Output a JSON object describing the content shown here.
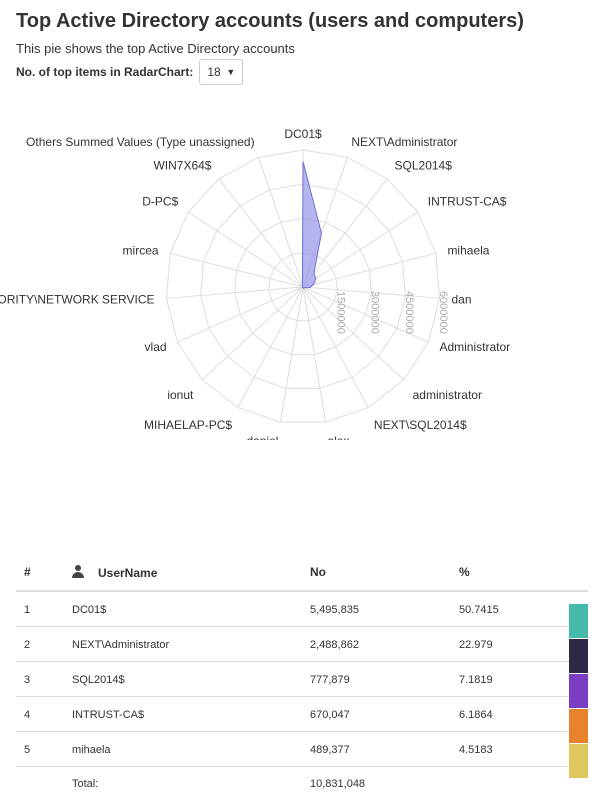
{
  "header": {
    "title": "Top Active Directory accounts (users and computers)",
    "subtitle": "This pie shows the top Active Directory accounts",
    "topn_label": "No. of top items in RadarChart:",
    "topn_value": "18"
  },
  "chart_data": {
    "type": "radar",
    "categories": [
      "DC01$",
      "NEXT\\Administrator",
      "SQL2014$",
      "INTRUST-CA$",
      "mihaela",
      "dan",
      "Administrator",
      "administrator",
      "NEXT\\SQL2014$",
      "alex",
      "daniel",
      "MIHAELAP-PC$",
      "ionut",
      "vlad",
      "NT AUTHORITY\\NETWORK SERVICE",
      "mircea",
      "D-PC$",
      "WIN7X64$",
      "Others Summed Values (Type unassigned)"
    ],
    "values": [
      5495835,
      2488862,
      777879,
      670047,
      489377,
      300000,
      70000,
      60000,
      50000,
      40000,
      30000,
      25000,
      20000,
      20000,
      30000,
      20000,
      20000,
      20000,
      80000
    ],
    "radial_ticks": [
      "1500000",
      "3000000",
      "4500000",
      "6000000"
    ],
    "rmax": 6000000,
    "fill_color": "#9b9bea",
    "stroke_color": "#7070d8",
    "grid_color": "#dddddd"
  },
  "table": {
    "columns": {
      "rank": "#",
      "user": "UserName",
      "no": "No",
      "pct": "%"
    },
    "rows": [
      {
        "rank": "1",
        "user": "DC01$",
        "no": "5,495,835",
        "pct": "50.7415",
        "color": "#45b9ab"
      },
      {
        "rank": "2",
        "user": "NEXT\\Administrator",
        "no": "2,488,862",
        "pct": "22.979",
        "color": "#2e2847"
      },
      {
        "rank": "3",
        "user": "SQL2014$",
        "no": "777,879",
        "pct": "7.1819",
        "color": "#7b3dc2"
      },
      {
        "rank": "4",
        "user": "INTRUST-CA$",
        "no": "670,047",
        "pct": "6.1864",
        "color": "#e8832b"
      },
      {
        "rank": "5",
        "user": "mihaela",
        "no": "489,377",
        "pct": "4.5183",
        "color": "#ddc75e"
      }
    ],
    "total_label": "Total:",
    "total_value": "10,831,048"
  }
}
